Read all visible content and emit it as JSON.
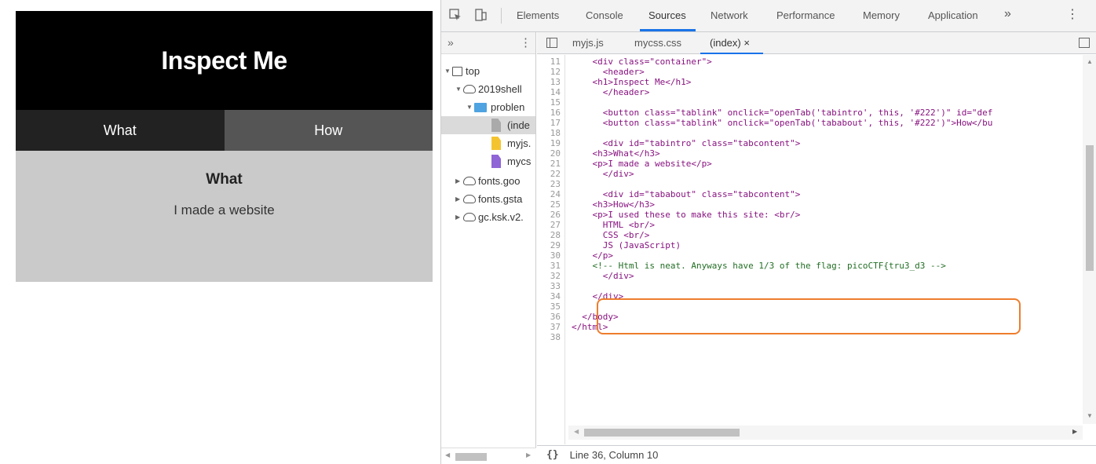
{
  "site": {
    "title": "Inspect Me",
    "tabs": [
      "What",
      "How"
    ],
    "content_heading": "What",
    "content_text": "I made a website"
  },
  "devtools": {
    "panel_tabs": [
      "Elements",
      "Console",
      "Sources",
      "Network",
      "Performance",
      "Memory",
      "Application"
    ],
    "active_panel": "Sources",
    "more_panels": "»",
    "navigator_chevron": "»",
    "tree": [
      {
        "label": "top",
        "icon": "frame-icon"
      },
      {
        "label": "2019shell",
        "icon": "cloud-icon"
      },
      {
        "label": "problen",
        "icon": "folder-icon"
      },
      {
        "label": "(inde",
        "icon": "file-gray-icon"
      },
      {
        "label": "myjs.",
        "icon": "file-yellow-icon"
      },
      {
        "label": "mycs",
        "icon": "file-purple-icon"
      },
      {
        "label": "fonts.goo",
        "icon": "cloud-icon"
      },
      {
        "label": "fonts.gsta",
        "icon": "cloud-icon"
      },
      {
        "label": "gc.ksk.v2.",
        "icon": "cloud-icon"
      }
    ],
    "file_tabs": [
      "myjs.js",
      "mycss.css",
      "(index)"
    ],
    "close_glyph": "×",
    "code_lines": [
      {
        "n": "11",
        "text": "    <div class=\"container\">"
      },
      {
        "n": "12",
        "text": "      <header>"
      },
      {
        "n": "13",
        "text": "    <h1>Inspect Me</h1>"
      },
      {
        "n": "14",
        "text": "      </header>"
      },
      {
        "n": "15",
        "text": ""
      },
      {
        "n": "16",
        "text": "      <button class=\"tablink\" onclick=\"openTab('tabintro', this, '#222')\" id=\"def"
      },
      {
        "n": "17",
        "text": "      <button class=\"tablink\" onclick=\"openTab('tababout', this, '#222')\">How</bu"
      },
      {
        "n": "18",
        "text": ""
      },
      {
        "n": "19",
        "text": "      <div id=\"tabintro\" class=\"tabcontent\">"
      },
      {
        "n": "20",
        "text": "    <h3>What</h3>"
      },
      {
        "n": "21",
        "text": "    <p>I made a website</p>"
      },
      {
        "n": "22",
        "text": "      </div>"
      },
      {
        "n": "23",
        "text": ""
      },
      {
        "n": "24",
        "text": "      <div id=\"tababout\" class=\"tabcontent\">"
      },
      {
        "n": "25",
        "text": "    <h3>How</h3>"
      },
      {
        "n": "26",
        "text": "    <p>I used these to make this site: <br/>"
      },
      {
        "n": "27",
        "text": "      HTML <br/>"
      },
      {
        "n": "28",
        "text": "      CSS <br/>"
      },
      {
        "n": "29",
        "text": "      JS (JavaScript)"
      },
      {
        "n": "30",
        "text": "    </p>"
      },
      {
        "n": "31",
        "text": "    <!-- Html is neat. Anyways have 1/3 of the flag: picoCTF{tru3_d3 -->"
      },
      {
        "n": "32",
        "text": "      </div>"
      },
      {
        "n": "33",
        "text": ""
      },
      {
        "n": "34",
        "text": "    </div>"
      },
      {
        "n": "35",
        "text": ""
      },
      {
        "n": "36",
        "text": "  </body>"
      },
      {
        "n": "37",
        "text": "</html>"
      },
      {
        "n": "38",
        "text": ""
      }
    ],
    "status": "Line 36, Column 10",
    "pretty_print": "{}"
  },
  "colors": {
    "accent": "#1a73e8",
    "highlight": "#ee7d2d",
    "tag": "#881280",
    "comment": "#236e25"
  }
}
